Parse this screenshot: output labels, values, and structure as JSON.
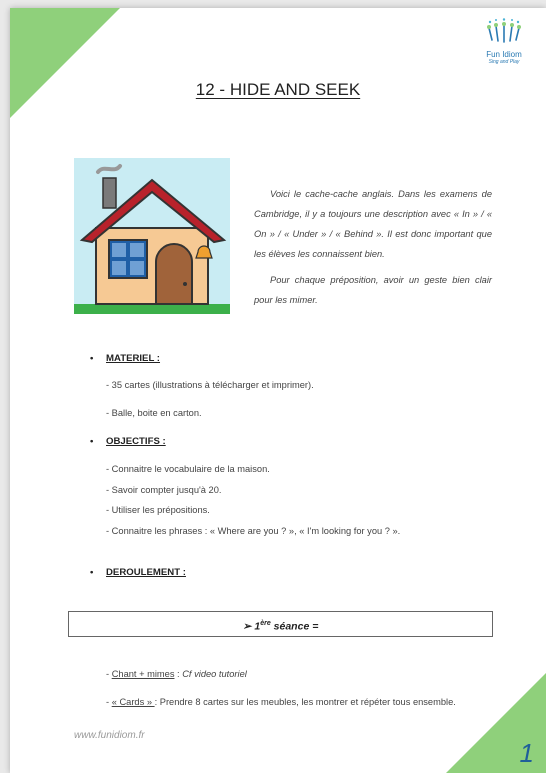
{
  "header": {
    "title": "12 - HIDE AND SEEK",
    "logo_name": "Fun Idiom",
    "logo_tag": "Sing and Play"
  },
  "intro": {
    "paragraph1": "Voici le cache-cache anglais. Dans les examens de Cambridge, il y a toujours une description avec « In » / « On » / « Under » / « Behind ». Il est donc important que les élèves les connaissent bien.",
    "paragraph2": "Pour chaque préposition, avoir un geste bien clair pour les mimer."
  },
  "materiel": {
    "label": "MATERIEL :",
    "items": [
      "- 35 cartes (illustrations à télécharger et imprimer).",
      "- Balle, boite en carton."
    ]
  },
  "objectifs": {
    "label": "OBJECTIFS :",
    "items": [
      "- Connaitre le vocabulaire de la maison.",
      "- Savoir compter jusqu'à 20.",
      "- Utiliser les prépositions.",
      "- Connaitre les phrases : « Where are you ? », « I'm looking for you ? »."
    ]
  },
  "deroulement": {
    "label": "DEROULEMENT :"
  },
  "seance": {
    "arrow": "➢",
    "num": "1",
    "sup": "ère",
    "rest": " séance ="
  },
  "activities": {
    "chant_dash": "- ",
    "chant_label": "Chant + mimes",
    "chant_sep": " : ",
    "chant_text": "Cf video tutoriel",
    "cards_dash": "- ",
    "cards_label": "« Cards » ",
    "cards_sep": ": ",
    "cards_text": "Prendre 8 cartes sur les meubles, les montrer et répéter tous ensemble."
  },
  "footer": {
    "url": "www.funidiom.fr",
    "page_number": "1"
  },
  "colors": {
    "accent_green": "#8fd07b",
    "logo_blue": "#2a7ab3",
    "page_number_blue": "#1f5f9a"
  }
}
